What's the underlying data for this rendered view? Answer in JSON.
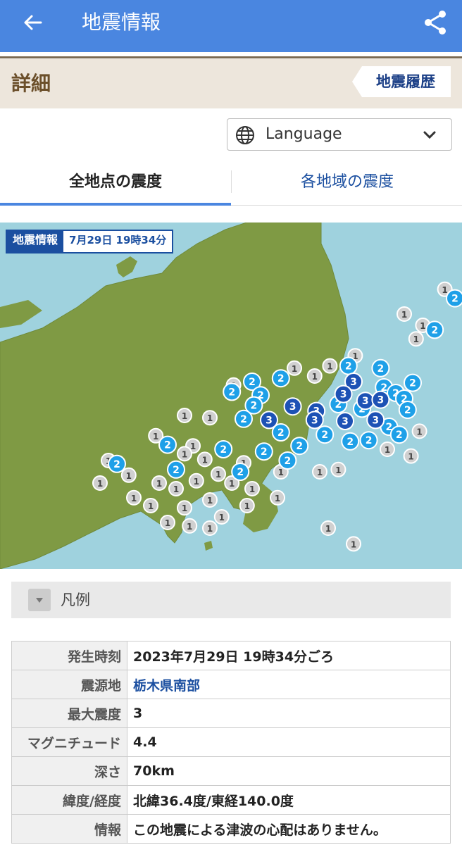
{
  "appbar": {
    "title": "地震情報",
    "back_icon": "arrow-left-icon",
    "share_icon": "share-icon"
  },
  "detail": {
    "label": "詳細",
    "history_button": "地震履歴"
  },
  "language": {
    "label": "Language",
    "icon": "globe-icon"
  },
  "tabs": {
    "all_points": "全地点の震度",
    "by_region": "各地域の震度",
    "active": "全地点の震度"
  },
  "map": {
    "badge_title": "地震情報",
    "badge_datetime": "7月29日 19時34分",
    "colors": {
      "land": "#7f9a44",
      "sea": "#9fd2de",
      "int1": "#d0d0d0",
      "int2": "#1ea0e8",
      "int3": "#1d52b5"
    },
    "markers": [
      {
        "i": 1,
        "lon": 140.93,
        "lat": 37.7
      },
      {
        "i": 1,
        "lon": 140.59,
        "lat": 37.32
      },
      {
        "i": 2,
        "lon": 140.65,
        "lat": 37.24
      },
      {
        "i": 1,
        "lon": 140.77,
        "lat": 37.12
      },
      {
        "i": 1,
        "lon": 140.9,
        "lat": 37.11
      },
      {
        "i": 1,
        "lon": 141.02,
        "lat": 37.13
      },
      {
        "i": 1,
        "lon": 141.04,
        "lat": 37.04
      },
      {
        "i": 1,
        "lon": 140.35,
        "lat": 37.1
      },
      {
        "i": 1,
        "lon": 140.46,
        "lat": 37.0
      },
      {
        "i": 2,
        "lon": 140.53,
        "lat": 36.96
      },
      {
        "i": 1,
        "lon": 140.42,
        "lat": 36.88
      },
      {
        "i": 1,
        "lon": 140.87,
        "lat": 36.89
      },
      {
        "i": 1,
        "lon": 140.99,
        "lat": 36.88
      },
      {
        "i": 1,
        "lon": 140.85,
        "lat": 36.78
      },
      {
        "i": 1,
        "lon": 140.06,
        "lat": 36.73
      },
      {
        "i": 1,
        "lon": 139.91,
        "lat": 36.64
      },
      {
        "i": 2,
        "lon": 140.02,
        "lat": 36.64
      },
      {
        "i": 2,
        "lon": 140.21,
        "lat": 36.62
      },
      {
        "i": 1,
        "lon": 139.7,
        "lat": 36.62
      },
      {
        "i": 1,
        "lon": 139.82,
        "lat": 36.55
      },
      {
        "i": 3,
        "lon": 140.05,
        "lat": 36.5
      },
      {
        "i": 2,
        "lon": 139.62,
        "lat": 36.53
      },
      {
        "i": 1,
        "lon": 139.34,
        "lat": 36.47
      },
      {
        "i": 2,
        "lon": 139.45,
        "lat": 36.5
      },
      {
        "i": 2,
        "lon": 139.33,
        "lat": 36.41
      },
      {
        "i": 2,
        "lon": 139.5,
        "lat": 36.38
      },
      {
        "i": 3,
        "lon": 139.99,
        "lat": 36.39
      },
      {
        "i": 2,
        "lon": 140.23,
        "lat": 36.45
      },
      {
        "i": 2,
        "lon": 140.4,
        "lat": 36.49
      },
      {
        "i": 2,
        "lon": 140.3,
        "lat": 36.4
      },
      {
        "i": 3,
        "lon": 140.12,
        "lat": 36.33
      },
      {
        "i": 3,
        "lon": 140.21,
        "lat": 36.34
      },
      {
        "i": 2,
        "lon": 140.35,
        "lat": 36.35
      },
      {
        "i": 2,
        "lon": 139.46,
        "lat": 36.29
      },
      {
        "i": 3,
        "lon": 139.69,
        "lat": 36.28
      },
      {
        "i": 3,
        "lon": 139.83,
        "lat": 36.24
      },
      {
        "i": 2,
        "lon": 139.96,
        "lat": 36.3
      },
      {
        "i": 2,
        "lon": 140.1,
        "lat": 36.26
      },
      {
        "i": 2,
        "lon": 140.37,
        "lat": 36.25
      },
      {
        "i": 3,
        "lon": 139.55,
        "lat": 36.16
      },
      {
        "i": 3,
        "lon": 139.82,
        "lat": 36.16
      },
      {
        "i": 3,
        "lon": 140.0,
        "lat": 36.15
      },
      {
        "i": 3,
        "lon": 140.18,
        "lat": 36.16
      },
      {
        "i": 2,
        "lon": 140.26,
        "lat": 36.1
      },
      {
        "i": 2,
        "lon": 139.4,
        "lat": 36.17
      },
      {
        "i": 1,
        "lon": 139.2,
        "lat": 36.18
      },
      {
        "i": 1,
        "lon": 139.05,
        "lat": 36.2
      },
      {
        "i": 2,
        "lon": 139.62,
        "lat": 36.05
      },
      {
        "i": 2,
        "lon": 139.88,
        "lat": 36.03
      },
      {
        "i": 2,
        "lon": 140.03,
        "lat": 35.97
      },
      {
        "i": 2,
        "lon": 140.14,
        "lat": 35.98
      },
      {
        "i": 2,
        "lon": 140.32,
        "lat": 36.03
      },
      {
        "i": 1,
        "lon": 140.44,
        "lat": 36.06
      },
      {
        "i": 2,
        "lon": 139.73,
        "lat": 35.93
      },
      {
        "i": 2,
        "lon": 139.52,
        "lat": 35.88
      },
      {
        "i": 2,
        "lon": 139.66,
        "lat": 35.8
      },
      {
        "i": 2,
        "lon": 139.28,
        "lat": 35.9
      },
      {
        "i": 1,
        "lon": 139.1,
        "lat": 35.93
      },
      {
        "i": 1,
        "lon": 138.88,
        "lat": 36.02
      },
      {
        "i": 2,
        "lon": 138.95,
        "lat": 35.94
      },
      {
        "i": 1,
        "lon": 139.05,
        "lat": 35.86
      },
      {
        "i": 1,
        "lon": 139.17,
        "lat": 35.81
      },
      {
        "i": 1,
        "lon": 139.4,
        "lat": 35.78
      },
      {
        "i": 1,
        "lon": 140.25,
        "lat": 35.9
      },
      {
        "i": 1,
        "lon": 140.39,
        "lat": 35.84
      },
      {
        "i": 1,
        "lon": 139.62,
        "lat": 35.7
      },
      {
        "i": 1,
        "lon": 139.85,
        "lat": 35.7
      },
      {
        "i": 1,
        "lon": 139.96,
        "lat": 35.72
      },
      {
        "i": 1,
        "lon": 139.25,
        "lat": 35.68
      },
      {
        "i": 1,
        "lon": 139.33,
        "lat": 35.6
      },
      {
        "i": 1,
        "lon": 139.45,
        "lat": 35.55
      },
      {
        "i": 1,
        "lon": 139.6,
        "lat": 35.47
      },
      {
        "i": 1,
        "lon": 139.12,
        "lat": 35.62
      },
      {
        "i": 1,
        "lon": 139.0,
        "lat": 35.55
      },
      {
        "i": 1,
        "lon": 139.2,
        "lat": 35.45
      },
      {
        "i": 1,
        "lon": 139.42,
        "lat": 35.4
      },
      {
        "i": 1,
        "lon": 139.05,
        "lat": 35.38
      },
      {
        "i": 1,
        "lon": 138.95,
        "lat": 35.25
      },
      {
        "i": 1,
        "lon": 139.08,
        "lat": 35.22
      },
      {
        "i": 1,
        "lon": 139.2,
        "lat": 35.2
      },
      {
        "i": 1,
        "lon": 139.9,
        "lat": 35.2
      },
      {
        "i": 1,
        "lon": 140.05,
        "lat": 35.06
      },
      {
        "i": 1,
        "lon": 138.6,
        "lat": 35.8
      },
      {
        "i": 1,
        "lon": 138.72,
        "lat": 35.67
      },
      {
        "i": 1,
        "lon": 138.55,
        "lat": 35.6
      },
      {
        "i": 2,
        "lon": 138.65,
        "lat": 35.77
      },
      {
        "i": 1,
        "lon": 138.75,
        "lat": 35.47
      },
      {
        "i": 1,
        "lon": 138.85,
        "lat": 35.4
      },
      {
        "i": 1,
        "lon": 139.27,
        "lat": 35.3
      },
      {
        "i": 1,
        "lon": 138.9,
        "lat": 35.6
      },
      {
        "i": 2,
        "lon": 139.0,
        "lat": 35.72
      },
      {
        "i": 2,
        "lon": 139.38,
        "lat": 35.7
      }
    ]
  },
  "legend": {
    "label": "凡例"
  },
  "info_rows": [
    {
      "key": "発生時刻",
      "value": "2023年7月29日 19時34分ごろ"
    },
    {
      "key": "震源地",
      "value": "栃木県南部"
    },
    {
      "key": "最大震度",
      "value": "3"
    },
    {
      "key": "マグニチュード",
      "value": "4.4"
    },
    {
      "key": "深さ",
      "value": "70km"
    },
    {
      "key": "緯度/経度",
      "value": "北緯36.4度/東経140.0度"
    },
    {
      "key": "情報",
      "value": "この地震による津波の心配はありません。"
    }
  ]
}
